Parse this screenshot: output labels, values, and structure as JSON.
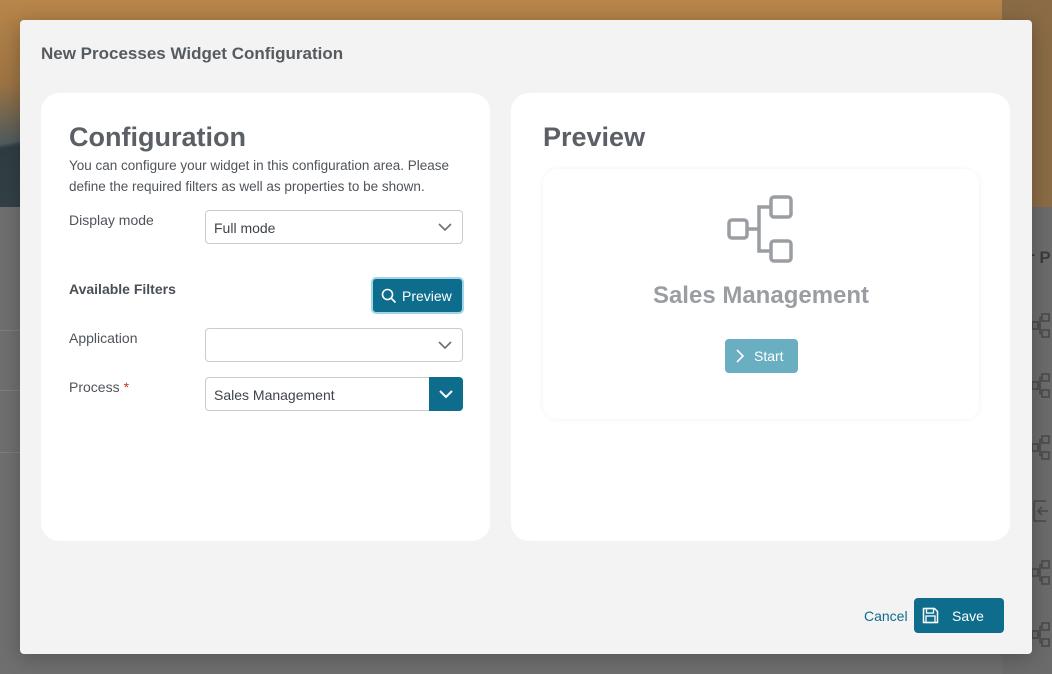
{
  "modal": {
    "title": "New Processes Widget Configuration",
    "save_label": "Save",
    "cancel_label": "Cancel"
  },
  "background": {
    "partial_header": "r P"
  },
  "config": {
    "heading": "Configuration",
    "description": "You can configure your widget in this configuration area. Please define the required filters as well as properties to be shown.",
    "display_mode": {
      "label": "Display mode",
      "value": "Full mode"
    },
    "filters_heading": "Available Filters",
    "preview_button": "Preview",
    "application": {
      "label": "Application",
      "value": ""
    },
    "process": {
      "label": "Process",
      "required_mark": "*",
      "value": "Sales Management"
    }
  },
  "preview": {
    "heading": "Preview",
    "process_name": "Sales Management",
    "start_label": "Start",
    "icon": "process-flow-icon"
  },
  "colors": {
    "accent": "#0e6d8c",
    "start_button": "#6aaec2",
    "panel_bg": "#ffffff",
    "modal_bg": "#f3f3f3"
  }
}
